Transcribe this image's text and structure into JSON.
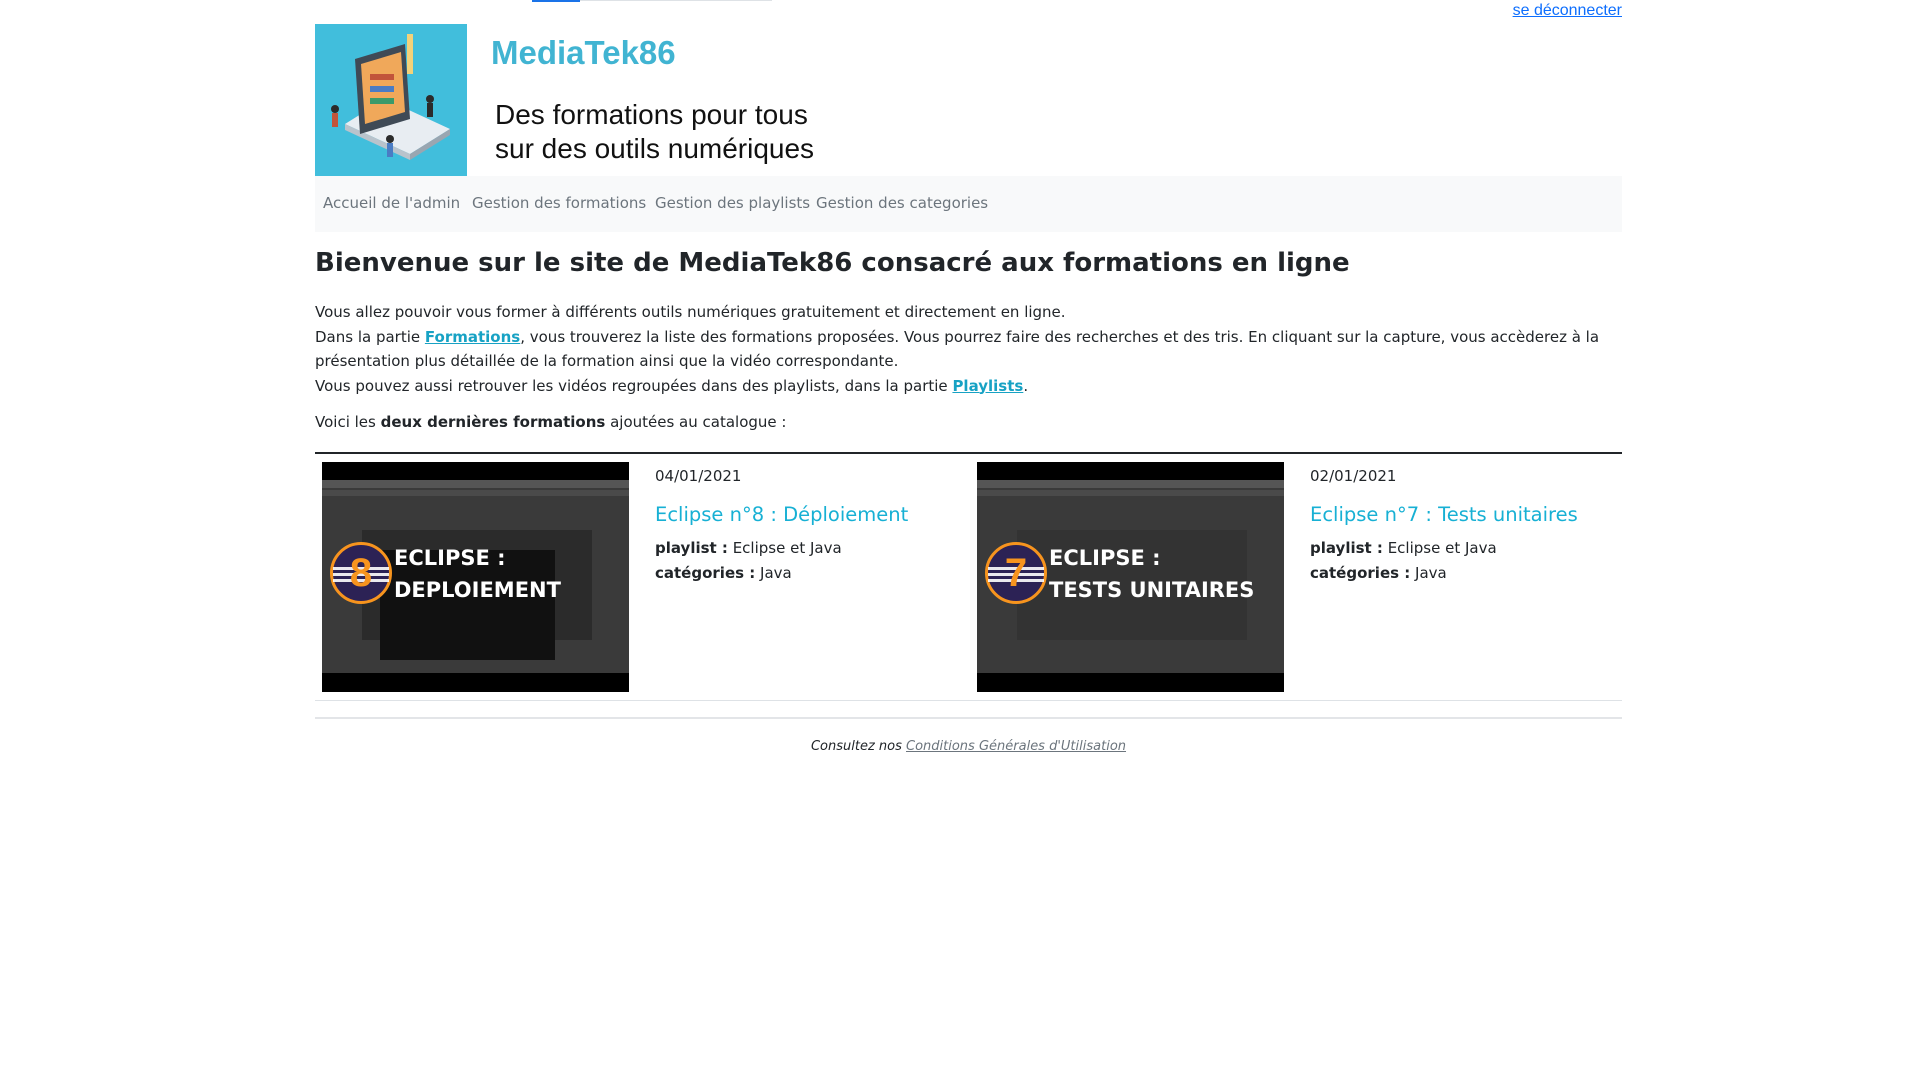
{
  "header": {
    "logout_label": "se déconnecter",
    "site_title": "MediaTek86",
    "tagline_line1": "Des formations pour tous",
    "tagline_line2": "sur des outils numériques"
  },
  "nav": {
    "items": [
      {
        "label": "Accueil de l'admin"
      },
      {
        "label": "Gestion des formations"
      },
      {
        "label": "Gestion des playlists"
      },
      {
        "label": "Gestion des categories"
      }
    ]
  },
  "main": {
    "heading": "Bienvenue sur le site de MediaTek86 consacré aux formations en ligne",
    "intro_line1": "Vous allez pouvoir vous former à différents outils numériques gratuitement et directement en ligne.",
    "intro_line2_before": "Dans la partie ",
    "intro_link_formations": "Formations",
    "intro_line2_after": ", vous trouverez la liste des formations proposées. Vous pourrez faire des recherches et des tris. En cliquant sur la capture, vous accèderez à la présentation plus détaillée de la formation ainsi que la vidéo correspondante.",
    "intro_line3_before": "Vous pouvez aussi retrouver les vidéos regroupées dans des playlists, dans la partie ",
    "intro_link_playlists": "Playlists",
    "intro_line3_after": ".",
    "voici_before": "Voici les ",
    "voici_bold": "deux dernières formations",
    "voici_after": " ajoutées au catalogue :"
  },
  "formations": [
    {
      "date": "04/01/2021",
      "title": "Eclipse n°8 : Déploiement",
      "playlist_label": "playlist :",
      "playlist": "Eclipse et Java",
      "categories_label": "catégories :",
      "categories": "Java",
      "thumb_number": "8",
      "thumb_line1": "ECLIPSE :",
      "thumb_line2": "DEPLOIEMENT"
    },
    {
      "date": "02/01/2021",
      "title": "Eclipse n°7 : Tests unitaires",
      "playlist_label": "playlist :",
      "playlist": "Eclipse et Java",
      "categories_label": "catégories :",
      "categories": "Java",
      "thumb_number": "7",
      "thumb_line1": "ECLIPSE :",
      "thumb_line2": "TESTS UNITAIRES"
    }
  ],
  "footer": {
    "text": "Consultez nos ",
    "link": "Conditions Générales d'Utilisation"
  },
  "colors": {
    "accent": "#17b0d4",
    "logo_bg": "#41bedc",
    "link": "#0d6efd",
    "navbar_bg": "#f8f9fa"
  }
}
